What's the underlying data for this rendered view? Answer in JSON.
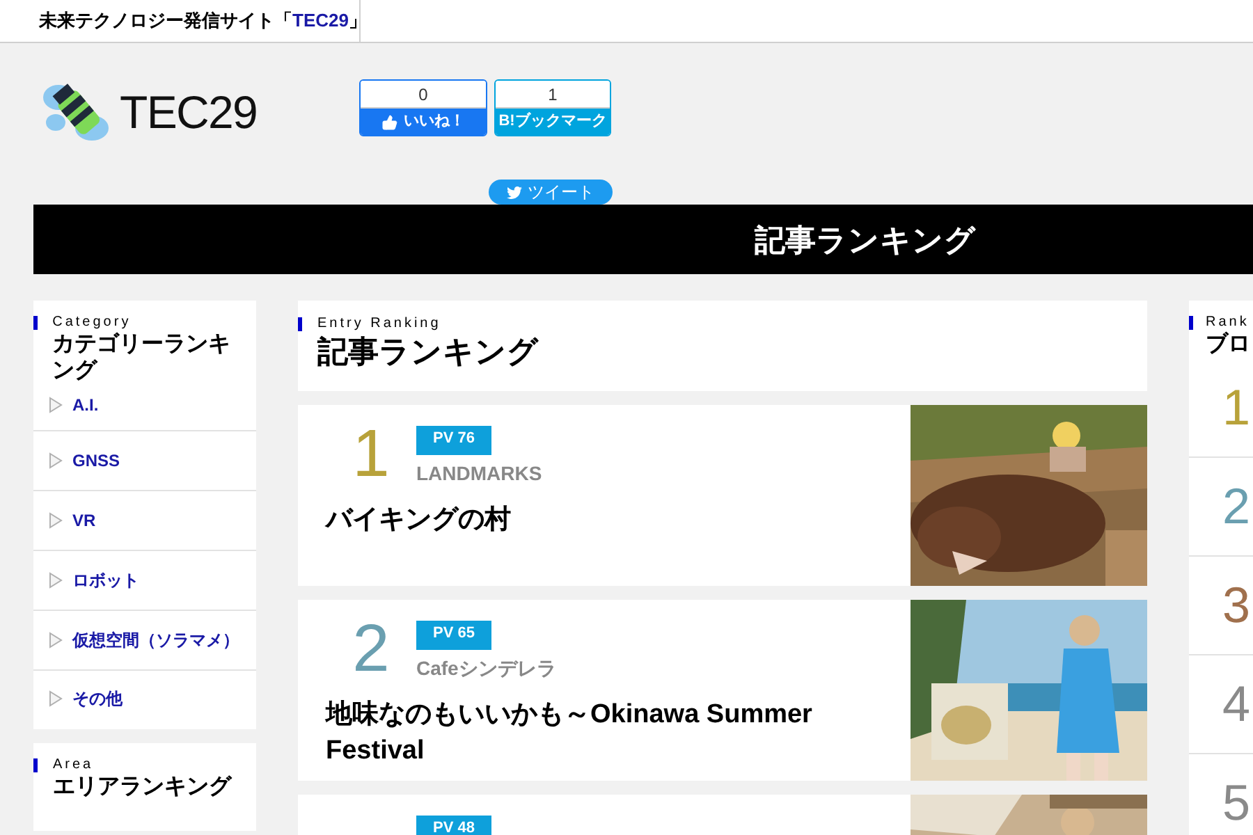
{
  "top_bar": {
    "title_prefix": "未来テクノロジー発信サイト「",
    "title_link": "TEC29",
    "title_suffix": "」"
  },
  "header": {
    "logo_text": "TEC29",
    "share_buttons": [
      {
        "kind": "facebook",
        "count": "0",
        "label": "いいね！"
      },
      {
        "kind": "hatena",
        "count": "1",
        "label": "B!ブックマーク"
      }
    ],
    "tweet_button": {
      "label": "ツイート"
    }
  },
  "banner": {
    "title": "記事ランキング"
  },
  "sidebar": {
    "sections": [
      {
        "eyebrow": "Category",
        "title": "カテゴリーランキング",
        "items": [
          "A.I.",
          "GNSS",
          "VR",
          "ロボット",
          "仮想空間（ソラマメ）",
          "その他"
        ]
      },
      {
        "eyebrow": "Area",
        "title": "エリアランキング"
      }
    ]
  },
  "main": {
    "eyebrow": "Entry Ranking",
    "title": "記事ランキング",
    "entries": [
      {
        "rank": "1",
        "color": "#b8a23a",
        "pv": "PV 76",
        "category": "LANDMARKS",
        "title": "バイキングの村"
      },
      {
        "rank": "2",
        "color": "#6a9fb0",
        "pv": "PV 65",
        "category": "Cafeシンデレラ",
        "title": "地味なのもいいかも～Okinawa Summer Festival"
      },
      {
        "pv": "PV 48"
      }
    ]
  },
  "right_column": {
    "eyebrow": "Rank",
    "title": "ブロ",
    "ranks": [
      {
        "rank": "1",
        "color": "#b8a23a"
      },
      {
        "rank": "2",
        "color": "#6a9fb0"
      },
      {
        "rank": "3",
        "color": "#a0704d"
      },
      {
        "rank": "4",
        "color": "#8a8a8a"
      },
      {
        "rank": "5",
        "color": "#8a8a8a"
      }
    ]
  }
}
